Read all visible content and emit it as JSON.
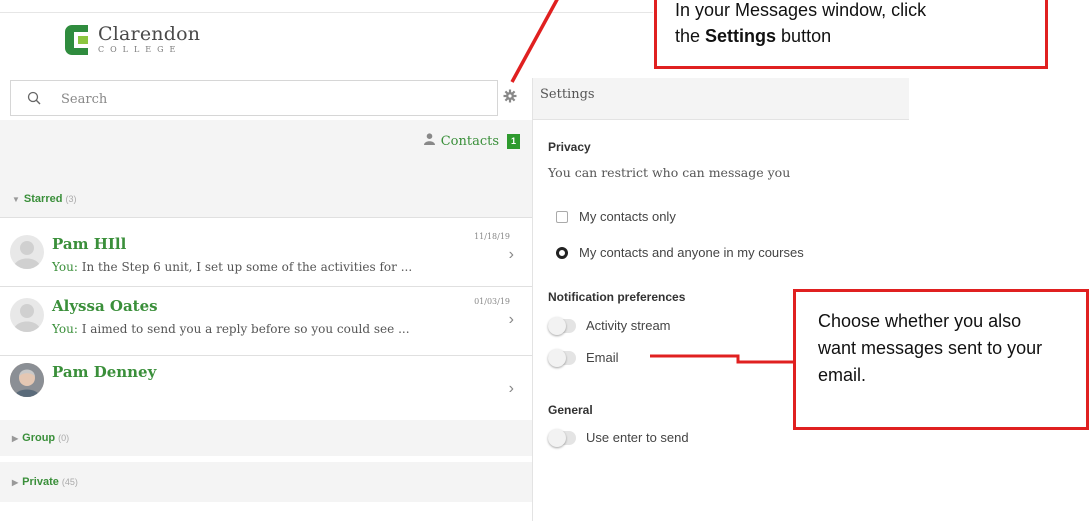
{
  "brand": {
    "name": "Clarendon",
    "sub": "COLLEGE",
    "colors": {
      "accent": "#3a8f3a",
      "callout": "#e02020"
    }
  },
  "search": {
    "placeholder": "Search",
    "value": ""
  },
  "settings_button_icon": "gear-icon",
  "contacts": {
    "icon": "person-icon",
    "label": "Contacts",
    "badge": "1"
  },
  "sections": {
    "starred": {
      "label": "Starred",
      "count": "(3)"
    },
    "group": {
      "label": "Group",
      "count": "(0)"
    },
    "private": {
      "label": "Private",
      "count": "(45)"
    }
  },
  "conversations": [
    {
      "name": "Pam HIll",
      "you": "You:",
      "preview": "In the Step 6 unit, I set up some of the activities for ...",
      "date": "11/18/19"
    },
    {
      "name": "Alyssa Oates",
      "you": "You:",
      "preview": "I aimed to send you a reply before so you could see ...",
      "date": "01/03/19"
    },
    {
      "name": "Pam Denney",
      "you": "",
      "preview": "",
      "date": ""
    }
  ],
  "settings": {
    "title": "Settings",
    "privacy": {
      "label": "Privacy",
      "desc": "You can restrict who can message you",
      "options": [
        {
          "label": "My contacts only",
          "selected": false
        },
        {
          "label": "My contacts and anyone in my courses",
          "selected": true
        }
      ]
    },
    "notifications": {
      "label": "Notification preferences",
      "options": [
        {
          "label": "Activity stream",
          "on": false
        },
        {
          "label": "Email",
          "on": false
        }
      ]
    },
    "general": {
      "label": "General",
      "options": [
        {
          "label": "Use enter to send",
          "on": false
        }
      ]
    }
  },
  "callouts": {
    "top": {
      "line1": "In your Messages window, click",
      "line2_pre": "the ",
      "line2_bold": "Settings",
      "line2_post": " button"
    },
    "bottom": {
      "text": "Choose whether you also want messages sent to your email."
    }
  }
}
